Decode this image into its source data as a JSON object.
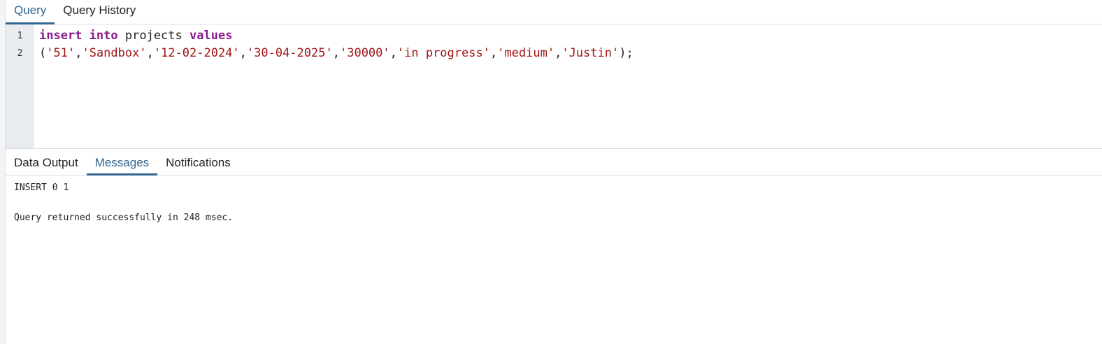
{
  "top_tabs": [
    {
      "label": "Query",
      "active": true
    },
    {
      "label": "Query History",
      "active": false
    }
  ],
  "editor": {
    "line_numbers": [
      "1",
      "2"
    ],
    "line1": {
      "kw_insert": "insert",
      "kw_into": "into",
      "table": "projects",
      "kw_values": "values"
    },
    "line2": {
      "open": "(",
      "values": [
        "'51'",
        "'Sandbox'",
        "'12-02-2024'",
        "'30-04-2025'",
        "'30000'",
        "'in progress'",
        "'medium'",
        "'Justin'"
      ],
      "separator": ",",
      "close": ");"
    }
  },
  "bottom_tabs": [
    {
      "label": "Data Output",
      "active": false
    },
    {
      "label": "Messages",
      "active": true
    },
    {
      "label": "Notifications",
      "active": false
    }
  ],
  "messages": {
    "line1": "INSERT 0 1",
    "line2": "",
    "line3": "Query returned successfully in 248 msec."
  },
  "colors": {
    "accent": "#326690",
    "keyword": "#8a1a8a",
    "string": "#a31515",
    "gutter": "#e9ecef"
  }
}
